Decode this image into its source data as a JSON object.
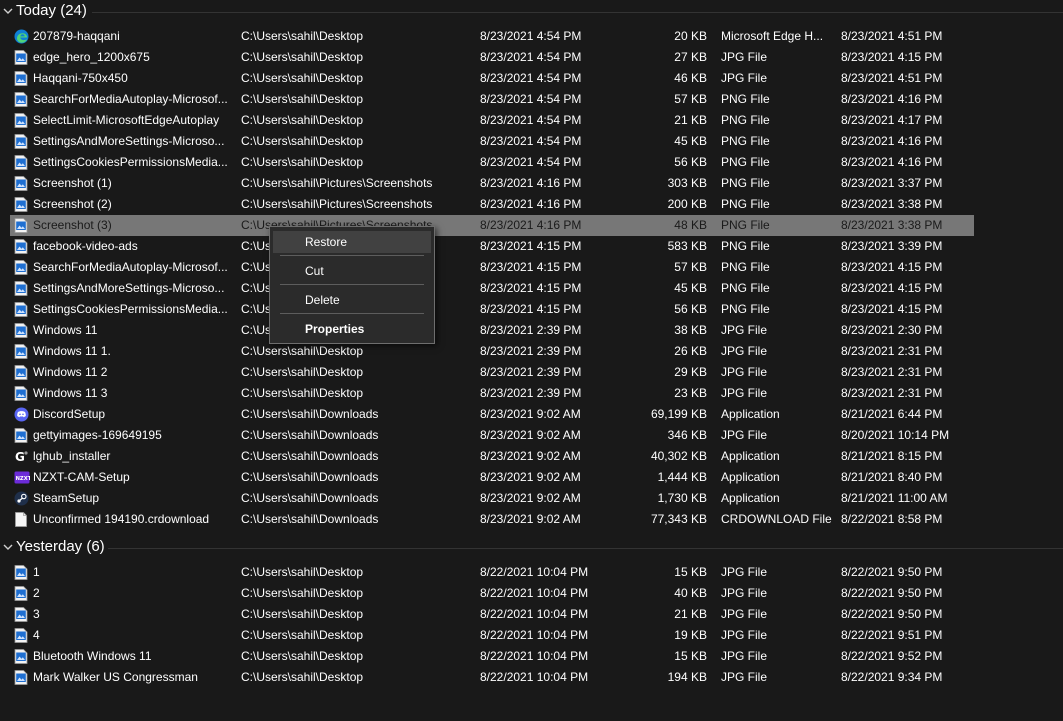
{
  "groups": [
    {
      "title": "Today (24)",
      "rows": [
        {
          "icon": "edge-icon",
          "name": "207879-haqqani",
          "path": "C:\\Users\\sahil\\Desktop",
          "modified": "8/23/2021 4:54 PM",
          "size": "20 KB",
          "type": "Microsoft Edge H...",
          "date": "8/23/2021 4:51 PM"
        },
        {
          "icon": "image-file-icon",
          "name": "edge_hero_1200x675",
          "path": "C:\\Users\\sahil\\Desktop",
          "modified": "8/23/2021 4:54 PM",
          "size": "27 KB",
          "type": "JPG File",
          "date": "8/23/2021 4:15 PM"
        },
        {
          "icon": "image-file-icon",
          "name": "Haqqani-750x450",
          "path": "C:\\Users\\sahil\\Desktop",
          "modified": "8/23/2021 4:54 PM",
          "size": "46 KB",
          "type": "JPG File",
          "date": "8/23/2021 4:51 PM"
        },
        {
          "icon": "image-file-icon",
          "name": "SearchForMediaAutoplay-Microsof...",
          "path": "C:\\Users\\sahil\\Desktop",
          "modified": "8/23/2021 4:54 PM",
          "size": "57 KB",
          "type": "PNG File",
          "date": "8/23/2021 4:16 PM"
        },
        {
          "icon": "image-file-icon",
          "name": "SelectLimit-MicrosoftEdgeAutoplay",
          "path": "C:\\Users\\sahil\\Desktop",
          "modified": "8/23/2021 4:54 PM",
          "size": "21 KB",
          "type": "PNG File",
          "date": "8/23/2021 4:17 PM"
        },
        {
          "icon": "image-file-icon",
          "name": "SettingsAndMoreSettings-Microso...",
          "path": "C:\\Users\\sahil\\Desktop",
          "modified": "8/23/2021 4:54 PM",
          "size": "45 KB",
          "type": "PNG File",
          "date": "8/23/2021 4:16 PM"
        },
        {
          "icon": "image-file-icon",
          "name": "SettingsCookiesPermissionsMedia...",
          "path": "C:\\Users\\sahil\\Desktop",
          "modified": "8/23/2021 4:54 PM",
          "size": "56 KB",
          "type": "PNG File",
          "date": "8/23/2021 4:16 PM"
        },
        {
          "icon": "image-file-icon",
          "name": "Screenshot (1)",
          "path": "C:\\Users\\sahil\\Pictures\\Screenshots",
          "modified": "8/23/2021 4:16 PM",
          "size": "303 KB",
          "type": "PNG File",
          "date": "8/23/2021 3:37 PM"
        },
        {
          "icon": "image-file-icon",
          "name": "Screenshot (2)",
          "path": "C:\\Users\\sahil\\Pictures\\Screenshots",
          "modified": "8/23/2021 4:16 PM",
          "size": "200 KB",
          "type": "PNG File",
          "date": "8/23/2021 3:38 PM"
        },
        {
          "icon": "image-file-icon",
          "name": "Screenshot (3)",
          "path": "C:\\Users\\sahil\\Pictures\\Screenshots",
          "modified": "8/23/2021 4:16 PM",
          "size": "48 KB",
          "type": "PNG File",
          "date": "8/23/2021 3:38 PM",
          "selected": true
        },
        {
          "icon": "image-file-icon",
          "name": "facebook-video-ads",
          "path": "C:\\Us",
          "modified": "8/23/2021 4:15 PM",
          "size": "583 KB",
          "type": "PNG File",
          "date": "8/23/2021 3:39 PM"
        },
        {
          "icon": "image-file-icon",
          "name": "SearchForMediaAutoplay-Microsof...",
          "path": "C:\\Us",
          "modified": "8/23/2021 4:15 PM",
          "size": "57 KB",
          "type": "PNG File",
          "date": "8/23/2021 4:15 PM"
        },
        {
          "icon": "image-file-icon",
          "name": "SettingsAndMoreSettings-Microso...",
          "path": "C:\\Us",
          "modified": "8/23/2021 4:15 PM",
          "size": "45 KB",
          "type": "PNG File",
          "date": "8/23/2021 4:15 PM"
        },
        {
          "icon": "image-file-icon",
          "name": "SettingsCookiesPermissionsMedia...",
          "path": "C:\\Us",
          "modified": "8/23/2021 4:15 PM",
          "size": "56 KB",
          "type": "PNG File",
          "date": "8/23/2021 4:15 PM"
        },
        {
          "icon": "image-file-icon",
          "name": "Windows 11",
          "path": "C:\\Us",
          "modified": "8/23/2021 2:39 PM",
          "size": "38 KB",
          "type": "JPG File",
          "date": "8/23/2021 2:30 PM"
        },
        {
          "icon": "image-file-icon",
          "name": "Windows 11 1.",
          "path": "C:\\Users\\sahil\\Desktop",
          "modified": "8/23/2021 2:39 PM",
          "size": "26 KB",
          "type": "JPG File",
          "date": "8/23/2021 2:31 PM"
        },
        {
          "icon": "image-file-icon",
          "name": "Windows 11 2",
          "path": "C:\\Users\\sahil\\Desktop",
          "modified": "8/23/2021 2:39 PM",
          "size": "29 KB",
          "type": "JPG File",
          "date": "8/23/2021 2:31 PM"
        },
        {
          "icon": "image-file-icon",
          "name": "Windows 11 3",
          "path": "C:\\Users\\sahil\\Desktop",
          "modified": "8/23/2021 2:39 PM",
          "size": "23 KB",
          "type": "JPG File",
          "date": "8/23/2021 2:31 PM"
        },
        {
          "icon": "discord-icon",
          "name": "DiscordSetup",
          "path": "C:\\Users\\sahil\\Downloads",
          "modified": "8/23/2021 9:02 AM",
          "size": "69,199 KB",
          "type": "Application",
          "date": "8/21/2021 6:44 PM"
        },
        {
          "icon": "image-file-icon",
          "name": "gettyimages-169649195",
          "path": "C:\\Users\\sahil\\Downloads",
          "modified": "8/23/2021 9:02 AM",
          "size": "346 KB",
          "type": "JPG File",
          "date": "8/20/2021 10:14 PM"
        },
        {
          "icon": "logitech-icon",
          "name": "lghub_installer",
          "path": "C:\\Users\\sahil\\Downloads",
          "modified": "8/23/2021 9:02 AM",
          "size": "40,302 KB",
          "type": "Application",
          "date": "8/21/2021 8:15 PM"
        },
        {
          "icon": "nzxt-icon",
          "name": "NZXT-CAM-Setup",
          "path": "C:\\Users\\sahil\\Downloads",
          "modified": "8/23/2021 9:02 AM",
          "size": "1,444 KB",
          "type": "Application",
          "date": "8/21/2021 8:40 PM"
        },
        {
          "icon": "steam-icon",
          "name": "SteamSetup",
          "path": "C:\\Users\\sahil\\Downloads",
          "modified": "8/23/2021 9:02 AM",
          "size": "1,730 KB",
          "type": "Application",
          "date": "8/21/2021 11:00 AM"
        },
        {
          "icon": "blank-file-icon",
          "name": "Unconfirmed 194190.crdownload",
          "path": "C:\\Users\\sahil\\Downloads",
          "modified": "8/23/2021 9:02 AM",
          "size": "77,343 KB",
          "type": "CRDOWNLOAD File",
          "date": "8/22/2021 8:58 PM"
        }
      ]
    },
    {
      "title": "Yesterday (6)",
      "rows": [
        {
          "icon": "image-file-icon",
          "name": "1",
          "path": "C:\\Users\\sahil\\Desktop",
          "modified": "8/22/2021 10:04 PM",
          "size": "15 KB",
          "type": "JPG File",
          "date": "8/22/2021 9:50 PM"
        },
        {
          "icon": "image-file-icon",
          "name": "2",
          "path": "C:\\Users\\sahil\\Desktop",
          "modified": "8/22/2021 10:04 PM",
          "size": "40 KB",
          "type": "JPG File",
          "date": "8/22/2021 9:50 PM"
        },
        {
          "icon": "image-file-icon",
          "name": "3",
          "path": "C:\\Users\\sahil\\Desktop",
          "modified": "8/22/2021 10:04 PM",
          "size": "21 KB",
          "type": "JPG File",
          "date": "8/22/2021 9:50 PM"
        },
        {
          "icon": "image-file-icon",
          "name": "4",
          "path": "C:\\Users\\sahil\\Desktop",
          "modified": "8/22/2021 10:04 PM",
          "size": "19 KB",
          "type": "JPG File",
          "date": "8/22/2021 9:51 PM"
        },
        {
          "icon": "image-file-icon",
          "name": "Bluetooth Windows 11",
          "path": "C:\\Users\\sahil\\Desktop",
          "modified": "8/22/2021 10:04 PM",
          "size": "15 KB",
          "type": "JPG File",
          "date": "8/22/2021 9:52 PM"
        },
        {
          "icon": "image-file-icon",
          "name": "Mark Walker US Congressman",
          "path": "C:\\Users\\sahil\\Desktop",
          "modified": "8/22/2021 10:04 PM",
          "size": "194 KB",
          "type": "JPG File",
          "date": "8/22/2021 9:34 PM"
        }
      ]
    }
  ],
  "context_menu": {
    "items": [
      {
        "label": "Restore",
        "hover": true
      },
      {
        "label": "Cut"
      },
      {
        "label": "Delete"
      },
      {
        "label": "Properties",
        "bold": true
      }
    ]
  },
  "colors": {
    "background": "#191919",
    "selection": "#777777",
    "menu_background": "#2b2b2b",
    "image_icon_blue": "#1f6fd1",
    "discord_blurple": "#5865f2",
    "nzxt_purple": "#6c2bd9"
  }
}
